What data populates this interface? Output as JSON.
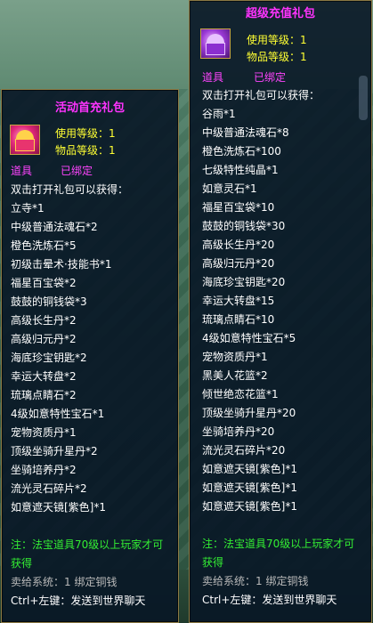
{
  "left_tooltip": {
    "title": "活动首充礼包",
    "use_level": "使用等级：1",
    "item_level": "物品等级：1",
    "type": "道具",
    "bound": "已绑定",
    "intro": "双击打开礼包可以获得：",
    "items": [
      "立寺*1",
      "中级普通法魂石*2",
      "橙色洗炼石*5",
      "初级击晕术·技能书*1",
      "福星百宝袋*2",
      "鼓鼓的铜钱袋*3",
      "高级长生丹*2",
      "高级归元丹*2",
      "海底珍宝钥匙*2",
      "幸运大转盘*2",
      "琉璃点睛石*2",
      "4级如意特性宝石*1",
      "宠物资质丹*1",
      "顶级坐骑升星丹*2",
      "坐骑培养丹*2",
      "流光灵石碎片*2",
      "如意遮天镜[紫色]*1"
    ],
    "note_line1": "注：法宝道具70级以上玩家才可",
    "note_line2": "获得",
    "sell": "卖给系统：1 绑定铜钱",
    "ctrl": "Ctrl+左键：发送到世界聊天"
  },
  "right_tooltip": {
    "title": "超级充值礼包",
    "use_level": "使用等级：1",
    "item_level": "物品等级：1",
    "type": "道具",
    "bound": "已绑定",
    "intro": "双击打开礼包可以获得：",
    "items": [
      "谷雨*1",
      "中级普通法魂石*8",
      "橙色洗炼石*100",
      "七级特性纯晶*1",
      "如意灵石*1",
      "福星百宝袋*10",
      "鼓鼓的铜钱袋*30",
      "高级长生丹*20",
      "高级归元丹*20",
      "海底珍宝钥匙*20",
      "幸运大转盘*15",
      "琉璃点睛石*10",
      "4级如意特性宝石*5",
      "宠物资质丹*1",
      "黑美人花篮*2",
      "倾世绝恋花篮*1",
      "顶级坐骑升星丹*20",
      "坐骑培养丹*20",
      "流光灵石碎片*20",
      "如意遮天镜[紫色]*1",
      "如意遮天镜[紫色]*1",
      "如意遮天镜[紫色]*1"
    ],
    "note_line1": "注：法宝道具70级以上玩家才可",
    "note_line2": "获得",
    "sell": "卖给系统：1 绑定铜钱",
    "ctrl": "Ctrl+左键：发送到世界聊天"
  },
  "colors": {
    "title": "#ff33ff",
    "stat": "#ffff33",
    "tag": "#ff44ff",
    "note": "#33ee33",
    "gray": "#b9b9b9"
  },
  "icons": [
    "gift-box-icon"
  ]
}
